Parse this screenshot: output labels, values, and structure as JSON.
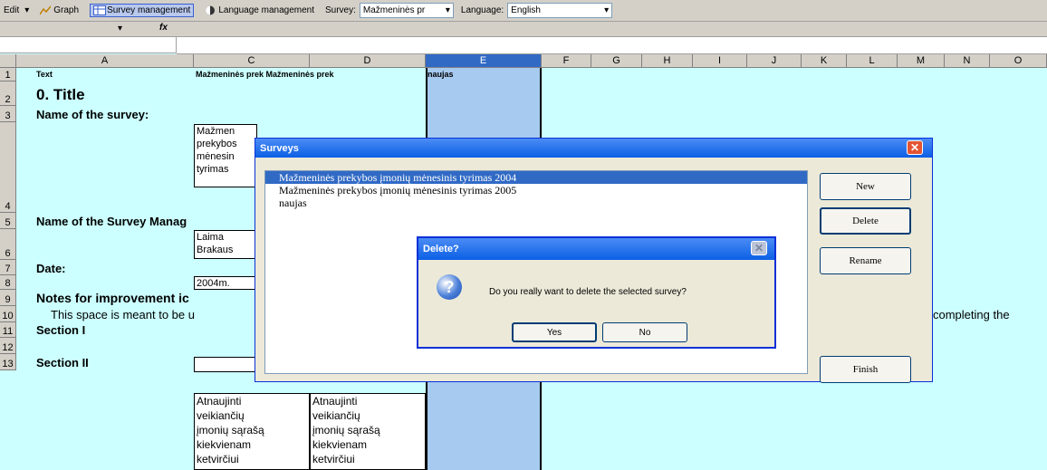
{
  "toolbar": {
    "edit_label": "Edit",
    "graph_label": "Graph",
    "survey_mgmt_label": "Survey management",
    "language_mgmt_label": "Language management",
    "survey_label": "Survey:",
    "survey_value": "Mažmeninės pr",
    "language_label": "Language:",
    "language_value": "English"
  },
  "formula_bar": {
    "fx": "fx"
  },
  "columns": [
    "A",
    "C",
    "D",
    "E",
    "F",
    "G",
    "H",
    "I",
    "J",
    "K",
    "L",
    "M",
    "N",
    "O"
  ],
  "rows": [
    "1",
    "2",
    "3",
    "4",
    "5",
    "6",
    "7",
    "8",
    "9",
    "10",
    "11",
    "12",
    "13"
  ],
  "sheet": {
    "r1_a": "Text",
    "r1_cd": "Mažmeninės prek Mažmeninės prek",
    "r1_e": "naujas",
    "title": "0. Title",
    "name_of_survey": "Name of the survey:",
    "survey_name_c": [
      "Mažmen",
      "prekybos",
      "mėnesin",
      "tyrimas"
    ],
    "name_of_manager": "Name of the Survey Manag",
    "manager_c": [
      "Laima",
      "Brakaus"
    ],
    "date_label": "Date:",
    "date_c": "2004m.",
    "notes_label": "Notes for improvement ic",
    "space_text": "This space is meant to be u",
    "completing_text": "completing the",
    "section1": "Section I",
    "section2": "Section II",
    "sec2_c": [
      "Atnaujinti",
      "veikiančių",
      "įmonių sąrašą",
      "kiekvienam",
      "ketvirčiui"
    ],
    "sec2_d": [
      "Atnaujinti",
      "veikiančių",
      "įmonių sąrašą",
      "kiekvienam",
      "ketvirčiui"
    ]
  },
  "surveys_dialog": {
    "title": "Surveys",
    "items": [
      "Mažmeninės prekybos įmonių mėnesinis tyrimas 2004",
      "Mažmeninės prekybos įmonių mėnesinis tyrimas 2005",
      "naujas"
    ],
    "new_label": "New",
    "delete_label": "Delete",
    "rename_label": "Rename",
    "finish_label": "Finish"
  },
  "delete_dialog": {
    "title": "Delete?",
    "message": "Do you really want to delete the selected survey?",
    "yes_label": "Yes",
    "no_label": "No"
  }
}
